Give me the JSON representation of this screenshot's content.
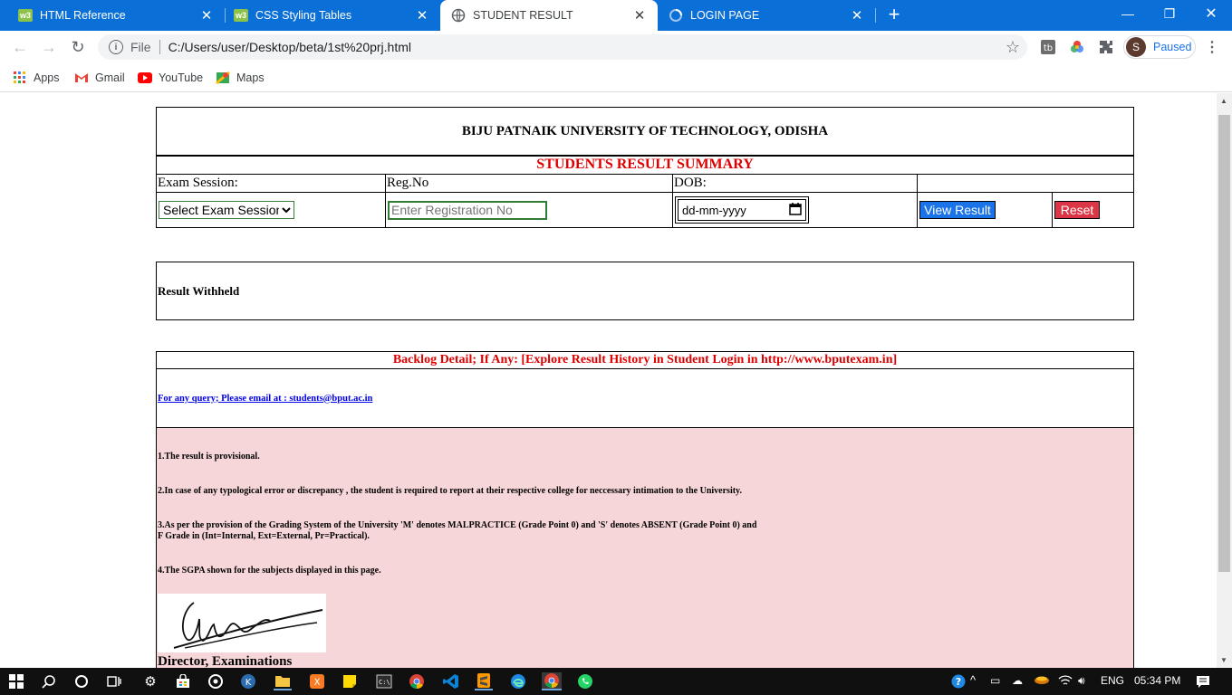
{
  "browser": {
    "tabs": [
      {
        "title": "HTML Reference",
        "icon": "w3schools-icon",
        "active": false
      },
      {
        "title": "CSS Styling Tables",
        "icon": "w3schools-icon",
        "active": false
      },
      {
        "title": "STUDENT RESULT",
        "icon": "globe-icon",
        "active": true
      },
      {
        "title": "LOGIN PAGE",
        "icon": "loading-icon",
        "active": false
      }
    ],
    "address": {
      "scheme": "File",
      "url": "C:/Users/user/Desktop/beta/1st%20prj.html"
    },
    "profile": {
      "initial": "S",
      "status": "Paused"
    },
    "bookmarks": [
      {
        "label": "Apps",
        "icon": "apps-grid-icon"
      },
      {
        "label": "Gmail",
        "icon": "gmail-icon"
      },
      {
        "label": "YouTube",
        "icon": "youtube-icon"
      },
      {
        "label": "Maps",
        "icon": "maps-icon"
      }
    ]
  },
  "page": {
    "university": "BIJU PATNAIK UNIVERSITY OF TECHNOLOGY, ODISHA",
    "summary_title": "STUDENTS RESULT SUMMARY",
    "form": {
      "exam_session_label": "Exam Session:",
      "reg_label": "Reg.No",
      "dob_label": "DOB:",
      "exam_session_selected": "Select Exam Session",
      "reg_placeholder": "Enter Registration No",
      "dob_placeholder": "dd-mm-yyyy",
      "view_button": "View Result",
      "reset_button": "Reset"
    },
    "withheld_text": "Result Withheld",
    "backlog_heading": "Backlog Detail; If Any: [Explore Result History in Student Login in http://www.bputexam.in]",
    "query_text": "For any query;  Please email at : students@bput.ac.in",
    "notes": [
      "1.The result is provisional.",
      "2.In case of any typological error or discrepancy , the student is required to report at their respective college for neccessary intimation to the University.",
      "3.As per the provision of the Grading System of the University 'M' denotes MALPRACTICE (Grade Point 0) and 'S' denotes ABSENT (Grade Point 0) and",
      "F Grade in (Int=Internal, Ext=External, Pr=Practical).",
      "4.The SGPA shown for the subjects displayed in this page."
    ],
    "signatory": "Director, Examinations"
  },
  "taskbar": {
    "language": "ENG",
    "time": "05:34 PM",
    "apps": [
      "start-icon",
      "search-icon",
      "cortana-icon",
      "task-view-icon",
      "settings-icon",
      "store-icon",
      "media-icon",
      "network-icon",
      "file-explorer-icon",
      "xampp-icon",
      "sticky-notes-icon",
      "terminal-icon",
      "chrome-icon",
      "vscode-icon",
      "sublime-icon",
      "edge-icon",
      "chrome-active-icon",
      "whatsapp-icon"
    ]
  },
  "colors": {
    "tabstrip": "#0a6fd6",
    "accent_red": "#e00000",
    "notes_bg": "#f6d6d8",
    "view_button": "#1a73e8",
    "reset_button": "#dc3545"
  }
}
